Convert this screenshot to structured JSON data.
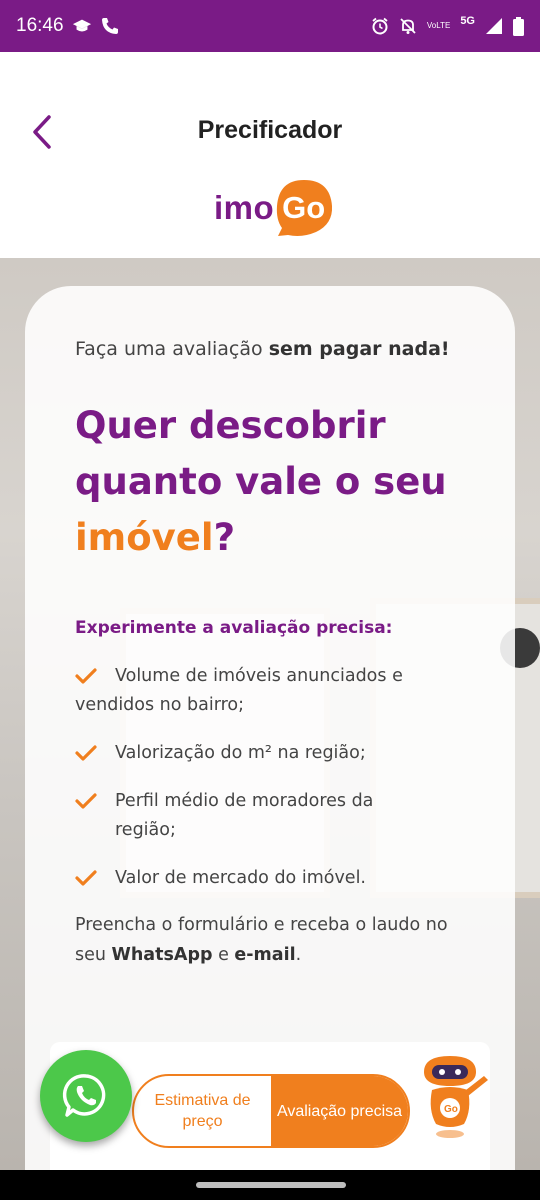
{
  "status_bar": {
    "time": "16:46",
    "left_icons": [
      "graduation-cap-icon",
      "phone-icon"
    ],
    "right_icons": [
      "alarm-icon",
      "bell-off-icon",
      "volte-icon",
      "5g-icon",
      "signal-icon",
      "battery-icon"
    ],
    "volte_line1": "Vo",
    "volte_line2": "LTE",
    "network": "5G"
  },
  "header": {
    "title": "Precificador",
    "logo_text_a": "imo",
    "logo_text_b": "Go"
  },
  "card": {
    "intro_plain": "Faça uma avaliação ",
    "intro_bold": "sem pagar nada!",
    "headline_a": "Quer descobrir quanto vale o seu ",
    "headline_accent": "imóvel",
    "headline_end": "?",
    "subheading": "Experimente a avaliação precisa:",
    "bullets": [
      "Volume de imóveis anunciados e vendidos no bairro;",
      "Valorização do m² na região;",
      "Perfil médio de moradores da região;",
      "Valor de mercado do imóvel."
    ],
    "footer_a": "Preencha o formulário e receba o laudo no seu ",
    "footer_b": "WhatsApp",
    "footer_c": " e ",
    "footer_d": "e-mail",
    "footer_e": "."
  },
  "toggle": {
    "option_a": "Estimativa de preço",
    "option_b": "Avaliação precisa",
    "selected": "Avaliação precisa"
  },
  "colors": {
    "purple": "#7a1b86",
    "orange": "#f07f1e",
    "whatsapp": "#4cc84a"
  }
}
